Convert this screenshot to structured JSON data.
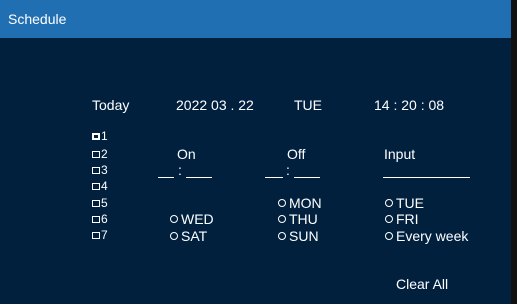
{
  "title": "Schedule",
  "header": {
    "today_label": "Today",
    "date": "2022 03 . 22",
    "day": "TUE",
    "time": "14 : 20 : 08"
  },
  "slots": [
    "1",
    "2",
    "3",
    "4",
    "5",
    "6",
    "7"
  ],
  "columns": {
    "on": "On",
    "off": "Off",
    "input": "Input"
  },
  "time_separator": ":",
  "days": {
    "mon": "MON",
    "tue": "TUE",
    "wed": "WED",
    "thu": "THU",
    "fri": "FRI",
    "sat": "SAT",
    "sun": "SUN",
    "every_week": "Every week"
  },
  "clear_all": "Clear All"
}
